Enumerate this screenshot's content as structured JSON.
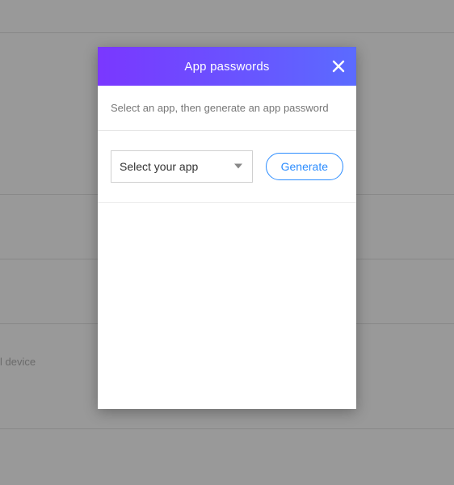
{
  "background": {
    "partial_text": "l device"
  },
  "modal": {
    "title": "App passwords",
    "instructions": "Select an app, then generate an app password",
    "select": {
      "placeholder": "Select your app"
    },
    "generate_label": "Generate"
  }
}
